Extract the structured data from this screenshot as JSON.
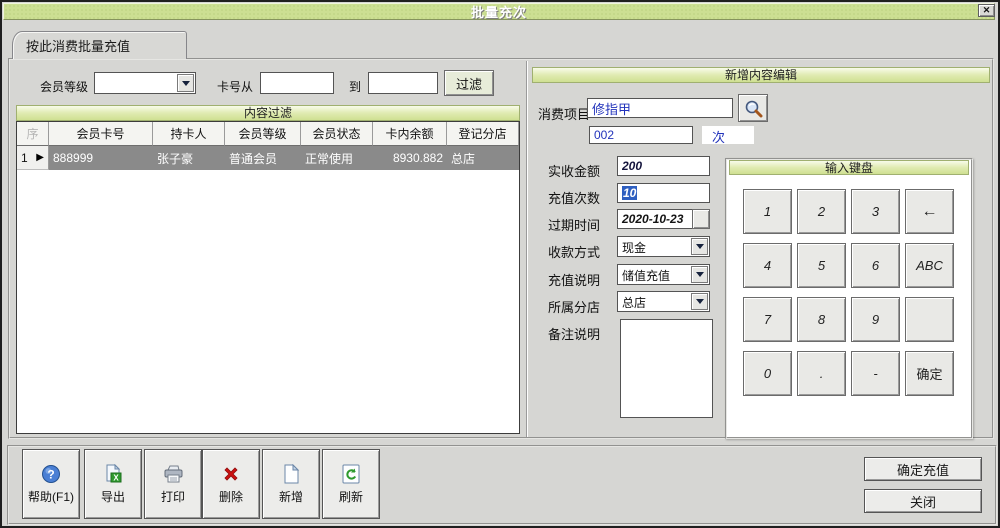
{
  "colors": {
    "titlebar_green": "#ccdf93",
    "header_green": "#d9e7a5",
    "selection_blue": "#2e5fc0",
    "value_blue": "#2233bb",
    "delete_red": "#cc1111"
  },
  "window": {
    "title": "批量充次",
    "close_glyph": "✕"
  },
  "tab": {
    "label": "按此消费批量充值"
  },
  "filter": {
    "member_level_label": "会员等级",
    "card_from_label": "卡号从",
    "to_label": "到",
    "filter_button_label": "过滤"
  },
  "list": {
    "header_title": "内容过滤",
    "columns": [
      "序",
      "会员卡号",
      "持卡人",
      "会员等级",
      "会员状态",
      "卡内余额",
      "登记分店"
    ],
    "rows": [
      {
        "index": "1",
        "marker": "▶",
        "card_no": "888999",
        "holder": "张子豪",
        "level": "普通会员",
        "status": "正常使用",
        "balance": "8930.882",
        "branch": "总店"
      }
    ]
  },
  "edit": {
    "header_title": "新增内容编辑",
    "item_label": "消费项目",
    "item_value": "修指甲",
    "item_code": "002",
    "unit": "次",
    "amount_label": "实收金额",
    "amount_value": "200",
    "times_label": "充值次数",
    "times_value": "10",
    "expire_label": "过期时间",
    "expire_value": "2020-10-23",
    "payment_label": "收款方式",
    "payment_value": "现金",
    "recharge_label": "充值说明",
    "recharge_value": "储值充值",
    "branch_label": "所属分店",
    "branch_value": "总店",
    "remark_label": "备注说明"
  },
  "keypad": {
    "header_title": "输入键盘",
    "keys": [
      "1",
      "2",
      "3",
      "←",
      "4",
      "5",
      "6",
      "ABC",
      "7",
      "8",
      "9",
      "",
      "0",
      ".",
      "-",
      "确定"
    ]
  },
  "toolbar": {
    "buttons": [
      {
        "label": "帮助(F1)",
        "icon": "help-icon"
      },
      {
        "label": "导出",
        "icon": "export-icon"
      },
      {
        "label": "打印",
        "icon": "print-icon"
      },
      {
        "label": "删除",
        "icon": "delete-icon"
      },
      {
        "label": "新增",
        "icon": "new-icon"
      },
      {
        "label": "刷新",
        "icon": "refresh-icon"
      }
    ]
  },
  "actions": {
    "confirm_label": "确定充值",
    "close_label": "关闭"
  }
}
